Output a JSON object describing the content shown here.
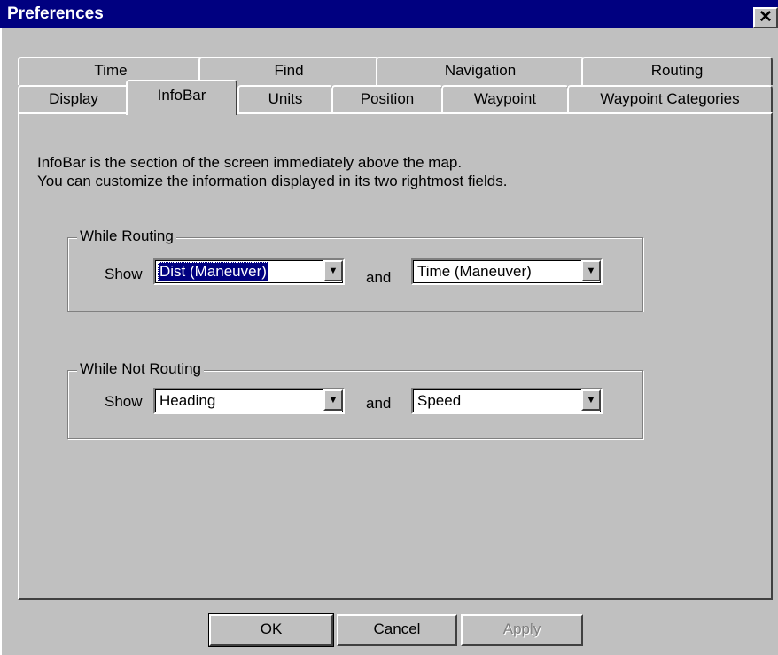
{
  "window": {
    "title": "Preferences",
    "close_glyph": "✕"
  },
  "tabs": {
    "back_row": [
      {
        "label": "Time"
      },
      {
        "label": "Find"
      },
      {
        "label": "Navigation"
      },
      {
        "label": "Routing"
      }
    ],
    "front_row": [
      {
        "label": "Display"
      },
      {
        "label": "InfoBar"
      },
      {
        "label": "Units"
      },
      {
        "label": "Position"
      },
      {
        "label": "Waypoint"
      },
      {
        "label": "Waypoint Categories"
      }
    ],
    "active": "InfoBar"
  },
  "infobar": {
    "description_line1": "InfoBar is the section of the screen immediately above the map.",
    "description_line2": "You can customize the information displayed in its two rightmost fields.",
    "while_routing": {
      "label": "While Routing",
      "show_label": "Show",
      "and_label": "and",
      "field1_value": "Dist (Maneuver)",
      "field2_value": "Time (Maneuver)"
    },
    "while_not_routing": {
      "label": "While Not Routing",
      "show_label": "Show",
      "and_label": "and",
      "field1_value": "Heading",
      "field2_value": "Speed"
    }
  },
  "buttons": {
    "ok": "OK",
    "cancel": "Cancel",
    "apply": "Apply"
  },
  "icons": {
    "dropdown_arrow": "▼"
  },
  "colors": {
    "title_bar": "#000080",
    "face": "#c0c0c0",
    "selection": "#000080"
  }
}
